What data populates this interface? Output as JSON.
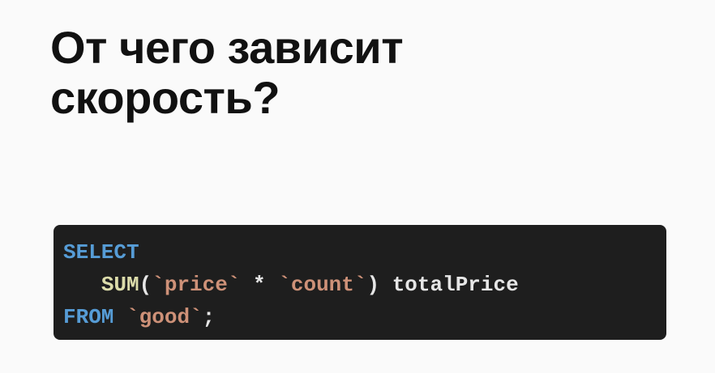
{
  "title": {
    "line1": "От чего зависит",
    "line2": "скорость?"
  },
  "code": {
    "language": "sql",
    "colors": {
      "background": "#1e1e1e",
      "keyword": "#569cd6",
      "function": "#dcdcaa",
      "identifier": "#ce9178",
      "text": "#e6e6e6"
    },
    "line1": {
      "keyword": "SELECT"
    },
    "line2": {
      "indent": "   ",
      "function": "SUM",
      "open_paren": "(",
      "ident1": "`price`",
      "operator": " * ",
      "ident2": "`count`",
      "close_paren": ")",
      "alias": " totalPrice"
    },
    "line3": {
      "keyword": "FROM",
      "space": " ",
      "table": "`good`",
      "terminator": ";"
    }
  }
}
